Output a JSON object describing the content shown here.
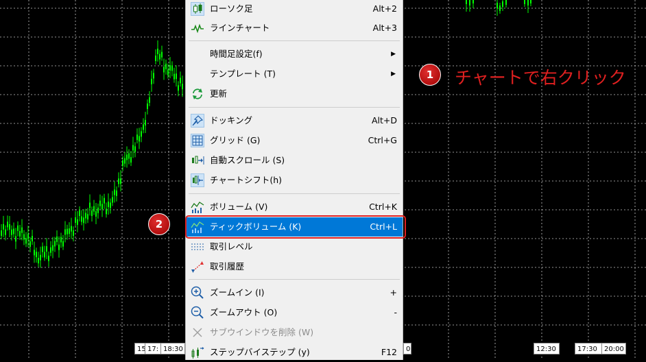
{
  "menu": {
    "items": [
      {
        "label": "ローソク足",
        "shortcut": "Alt+2",
        "icon": "candlestick-icon",
        "sel": true
      },
      {
        "label": "ラインチャート",
        "shortcut": "Alt+3",
        "icon": "line-chart-icon"
      },
      {
        "label": "時間足設定(f)",
        "submenu": true
      },
      {
        "label": "テンプレート (T)",
        "submenu": true
      },
      {
        "label": "更新",
        "icon": "refresh-icon"
      },
      {
        "label": "ドッキング",
        "shortcut": "Alt+D",
        "icon": "pin-icon",
        "sel": true
      },
      {
        "label": "グリッド (G)",
        "shortcut": "Ctrl+G",
        "icon": "grid-icon",
        "sel": true
      },
      {
        "label": "自動スクロール (S)",
        "icon": "auto-scroll-icon"
      },
      {
        "label": "チャートシフト(h)",
        "icon": "chart-shift-icon",
        "sel": true
      },
      {
        "label": "ボリューム (V)",
        "shortcut": "Ctrl+K",
        "icon": "volume-icon"
      },
      {
        "label": "ティックボリューム (K)",
        "shortcut": "Ctrl+L",
        "icon": "tick-volume-icon",
        "highlighted": true
      },
      {
        "label": "取引レベル",
        "icon": "trade-levels-icon"
      },
      {
        "label": "取引履歴",
        "icon": "trade-history-icon"
      },
      {
        "label": "ズームイン (I)",
        "shortcut": "+",
        "icon": "zoom-in-icon"
      },
      {
        "label": "ズームアウト (O)",
        "shortcut": "-",
        "icon": "zoom-out-icon"
      },
      {
        "label": "サブウインドウを削除 (W)",
        "icon": "close-icon",
        "disabled": true
      },
      {
        "label": "ステップバイステップ (y)",
        "shortcut": "F12",
        "icon": "step-icon"
      }
    ]
  },
  "callouts": {
    "badge1": "1",
    "badge2": "2",
    "text1": "チャートで右クリック"
  },
  "time_labels": [
    "15",
    "17:",
    "18:30",
    "0",
    "12:30",
    "17:30",
    "20:00"
  ],
  "colors": {
    "candle": "#00ff00",
    "grid": "#c8c8c8",
    "highlight": "#0078d7",
    "callout": "#e02020"
  }
}
